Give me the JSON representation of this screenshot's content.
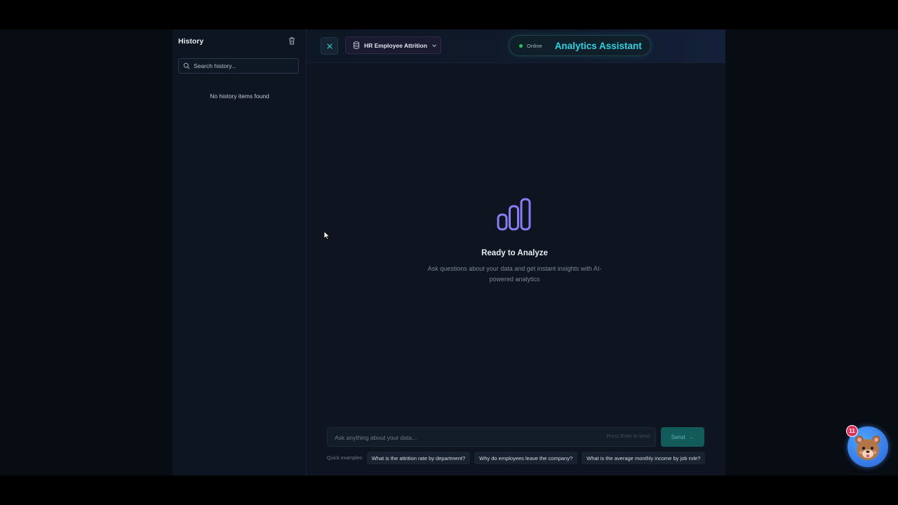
{
  "sidebar": {
    "title": "History",
    "search_placeholder": "Search history...",
    "empty_message": "No history items found"
  },
  "topbar": {
    "dataset_label": "HR Employee Attrition",
    "status_label": "Online",
    "assistant_title": "Analytics Assistant"
  },
  "hero": {
    "title": "Ready to Analyze",
    "subtitle": "Ask questions about your data and get instant insights with AI-powered analytics"
  },
  "chat": {
    "placeholder": "Ask anything about your data...",
    "enter_hint": "Press Enter to send",
    "send_label": "Send",
    "quick_label": "Quick examples:",
    "examples": [
      "What is the attrition rate by department?",
      "Why do employees leave the company?",
      "What is the average monthly income by job role?"
    ]
  },
  "assistant_widget": {
    "badge_count": "11",
    "icon": "bear-mascot-icon"
  },
  "colors": {
    "accent_cyan": "#2fd0e0",
    "status_green": "#22c55e",
    "icon_purple": "#8b7cf6",
    "badge_red": "#e1305a"
  }
}
